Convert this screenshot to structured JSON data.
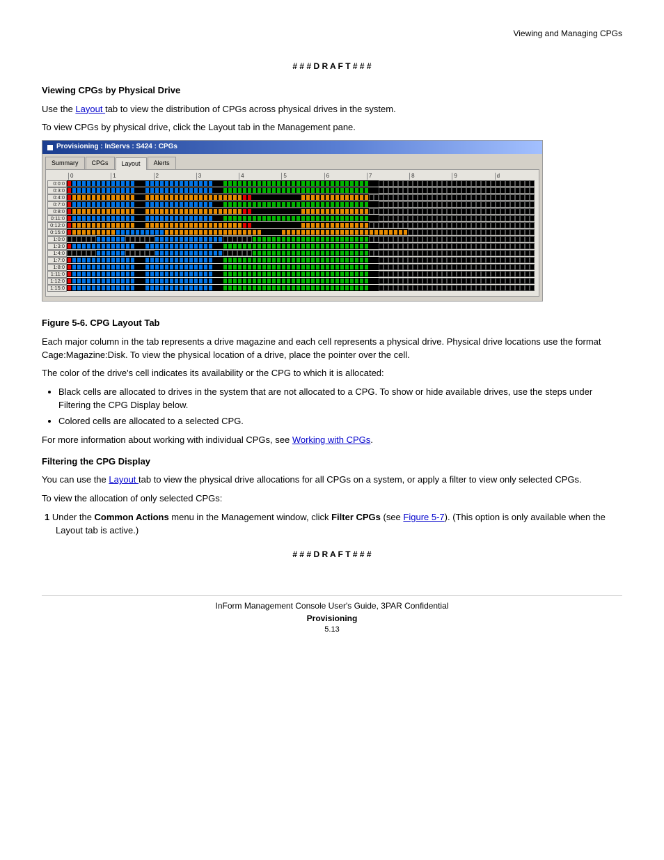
{
  "page_header_right": "Viewing and Managing CPGs",
  "banner": "# # # D R A F T # # #",
  "intro": {
    "h": "Viewing CPGs by Physical Drive",
    "p1_a": "Use the ",
    "p1_link": "Layout ",
    "p1_b": "tab to view the distribution of CPGs across physical drives in the system.",
    "p2": "To view CPGs by physical drive, click the Layout tab in the Management pane."
  },
  "screenshot": {
    "title": "Provisioning : InServs : S424 : CPGs",
    "tabs": [
      "Summary",
      "CPGs",
      "Layout",
      "Alerts"
    ],
    "active_tab": "Layout",
    "col_groups": [
      "0",
      "1",
      "2",
      "3",
      "4",
      "5",
      "6",
      "7",
      "8",
      "9",
      "d"
    ],
    "rows": [
      {
        "label": "0:0:0",
        "pattern": "gridA"
      },
      {
        "label": "0:3:0",
        "pattern": "gridA"
      },
      {
        "label": "0:4:0",
        "pattern": "gridB"
      },
      {
        "label": "0:7:0",
        "pattern": "gridA"
      },
      {
        "label": "0:8:0",
        "pattern": "gridB"
      },
      {
        "label": "0:11:0",
        "pattern": "gridA"
      },
      {
        "label": "0:12:0",
        "pattern": "gridB"
      },
      {
        "label": "0:15:0",
        "pattern": "gridC"
      },
      {
        "label": "1:0:0",
        "pattern": "gridD"
      },
      {
        "label": "1:3:0",
        "pattern": "gridA"
      },
      {
        "label": "1:4:0",
        "pattern": "gridD"
      },
      {
        "label": "1:7:0",
        "pattern": "gridA"
      },
      {
        "label": "1:8:0",
        "pattern": "gridA"
      },
      {
        "label": "1:11:0",
        "pattern": "gridA"
      },
      {
        "label": "1:12:0",
        "pattern": "gridA"
      },
      {
        "label": "1:15:0",
        "pattern": "gridA"
      }
    ]
  },
  "after_fig": {
    "caption": "Figure 5-6.  CPG Layout Tab",
    "p1": "Each major column in the tab represents a drive magazine and each cell represents a physical drive. Physical drive locations use the format Cage:Magazine:Disk. To view the physical location of a drive, place the pointer over the cell.",
    "p2": "The color of the drive's cell indicates its availability or the CPG to which it is allocated:",
    "li1": "Black cells are allocated to drives in the system that are not allocated to a CPG. To show or hide available drives, use the steps under Filtering the CPG Display below.",
    "li2": "Colored cells are allocated to a selected CPG.",
    "see1_a": "For more information about working with individual CPGs, see ",
    "see1_link": "Working with CPGs",
    "see1_b": ".",
    "sub_h": "Filtering the CPG Display",
    "sub_p_a": "You can use the ",
    "sub_p_link1": "Layout ",
    "sub_p_b": "tab to view the physical drive allocations for all CPGs on a system, or apply a filter to view only selected CPGs.",
    "steps_intro": "To view the allocation of only selected CPGs:",
    "step1_a": "1 ",
    "step1_b": "Under the ",
    "step1_bold": "Common Actions ",
    "step1_c": "menu in the Management window, click ",
    "step1_bold2": "Filter CPGs",
    "step1_d": " (see ",
    "step1_link": "Figure 5-7",
    "step1_e": "). (This option is only available when the Layout tab is active.)"
  },
  "footer": {
    "left": "InForm Management Console User's Guide, 3PAR Confidential",
    "title": "Provisioning",
    "sub": "5.13"
  }
}
